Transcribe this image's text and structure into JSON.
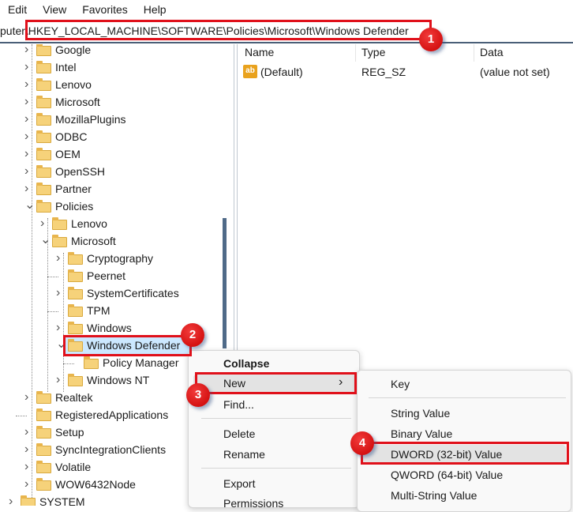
{
  "menu": [
    "Edit",
    "View",
    "Favorites",
    "Help"
  ],
  "address": {
    "value": "puter\\HKEY_LOCAL_MACHINE\\SOFTWARE\\Policies\\Microsoft\\Windows Defender"
  },
  "tree": [
    {
      "label": "Google",
      "level": 1,
      "state": "collapsed"
    },
    {
      "label": "Intel",
      "level": 1,
      "state": "collapsed"
    },
    {
      "label": "Lenovo",
      "level": 1,
      "state": "collapsed"
    },
    {
      "label": "Microsoft",
      "level": 1,
      "state": "collapsed"
    },
    {
      "label": "MozillaPlugins",
      "level": 1,
      "state": "collapsed"
    },
    {
      "label": "ODBC",
      "level": 1,
      "state": "collapsed"
    },
    {
      "label": "OEM",
      "level": 1,
      "state": "collapsed"
    },
    {
      "label": "OpenSSH",
      "level": 1,
      "state": "collapsed"
    },
    {
      "label": "Partner",
      "level": 1,
      "state": "collapsed"
    },
    {
      "label": "Policies",
      "level": 1,
      "state": "expanded"
    },
    {
      "label": "Lenovo",
      "level": 2,
      "state": "collapsed"
    },
    {
      "label": "Microsoft",
      "level": 2,
      "state": "expanded"
    },
    {
      "label": "Cryptography",
      "level": 3,
      "state": "collapsed"
    },
    {
      "label": "Peernet",
      "level": 3,
      "state": "leaf"
    },
    {
      "label": "SystemCertificates",
      "level": 3,
      "state": "collapsed"
    },
    {
      "label": "TPM",
      "level": 3,
      "state": "leaf"
    },
    {
      "label": "Windows",
      "level": 3,
      "state": "collapsed"
    },
    {
      "label": "Windows Defender",
      "level": 3,
      "state": "expanded",
      "selected": true
    },
    {
      "label": "Policy Manager",
      "level": 4,
      "state": "leaf"
    },
    {
      "label": "Windows NT",
      "level": 3,
      "state": "collapsed"
    },
    {
      "label": "Realtek",
      "level": 1,
      "state": "collapsed"
    },
    {
      "label": "RegisteredApplications",
      "level": 1,
      "state": "leaf"
    },
    {
      "label": "Setup",
      "level": 1,
      "state": "collapsed"
    },
    {
      "label": "SyncIntegrationClients",
      "level": 1,
      "state": "collapsed"
    },
    {
      "label": "Volatile",
      "level": 1,
      "state": "collapsed"
    },
    {
      "label": "WOW6432Node",
      "level": 1,
      "state": "collapsed"
    },
    {
      "label": "SYSTEM",
      "level": 0,
      "state": "collapsed"
    }
  ],
  "values_pane": {
    "columns": [
      "Name",
      "Type",
      "Data"
    ],
    "rows": [
      {
        "icon": "string-value-icon",
        "icon_text": "ab",
        "name": "(Default)",
        "type": "REG_SZ",
        "data": "(value not set)"
      }
    ]
  },
  "context_menu": {
    "items": [
      "Collapse",
      "New",
      "Find...",
      "Delete",
      "Rename",
      "Export",
      "Permissions"
    ],
    "submenu_arrow": "›"
  },
  "submenu": {
    "items": [
      "Key",
      "String Value",
      "Binary Value",
      "DWORD (32-bit) Value",
      "QWORD (64-bit) Value",
      "Multi-String Value"
    ]
  },
  "annotations": [
    "1",
    "2",
    "3",
    "4"
  ],
  "colors": {
    "annotation_red": "#e0101a",
    "folder": "#f6d27a",
    "selection": "#cce8ff"
  }
}
